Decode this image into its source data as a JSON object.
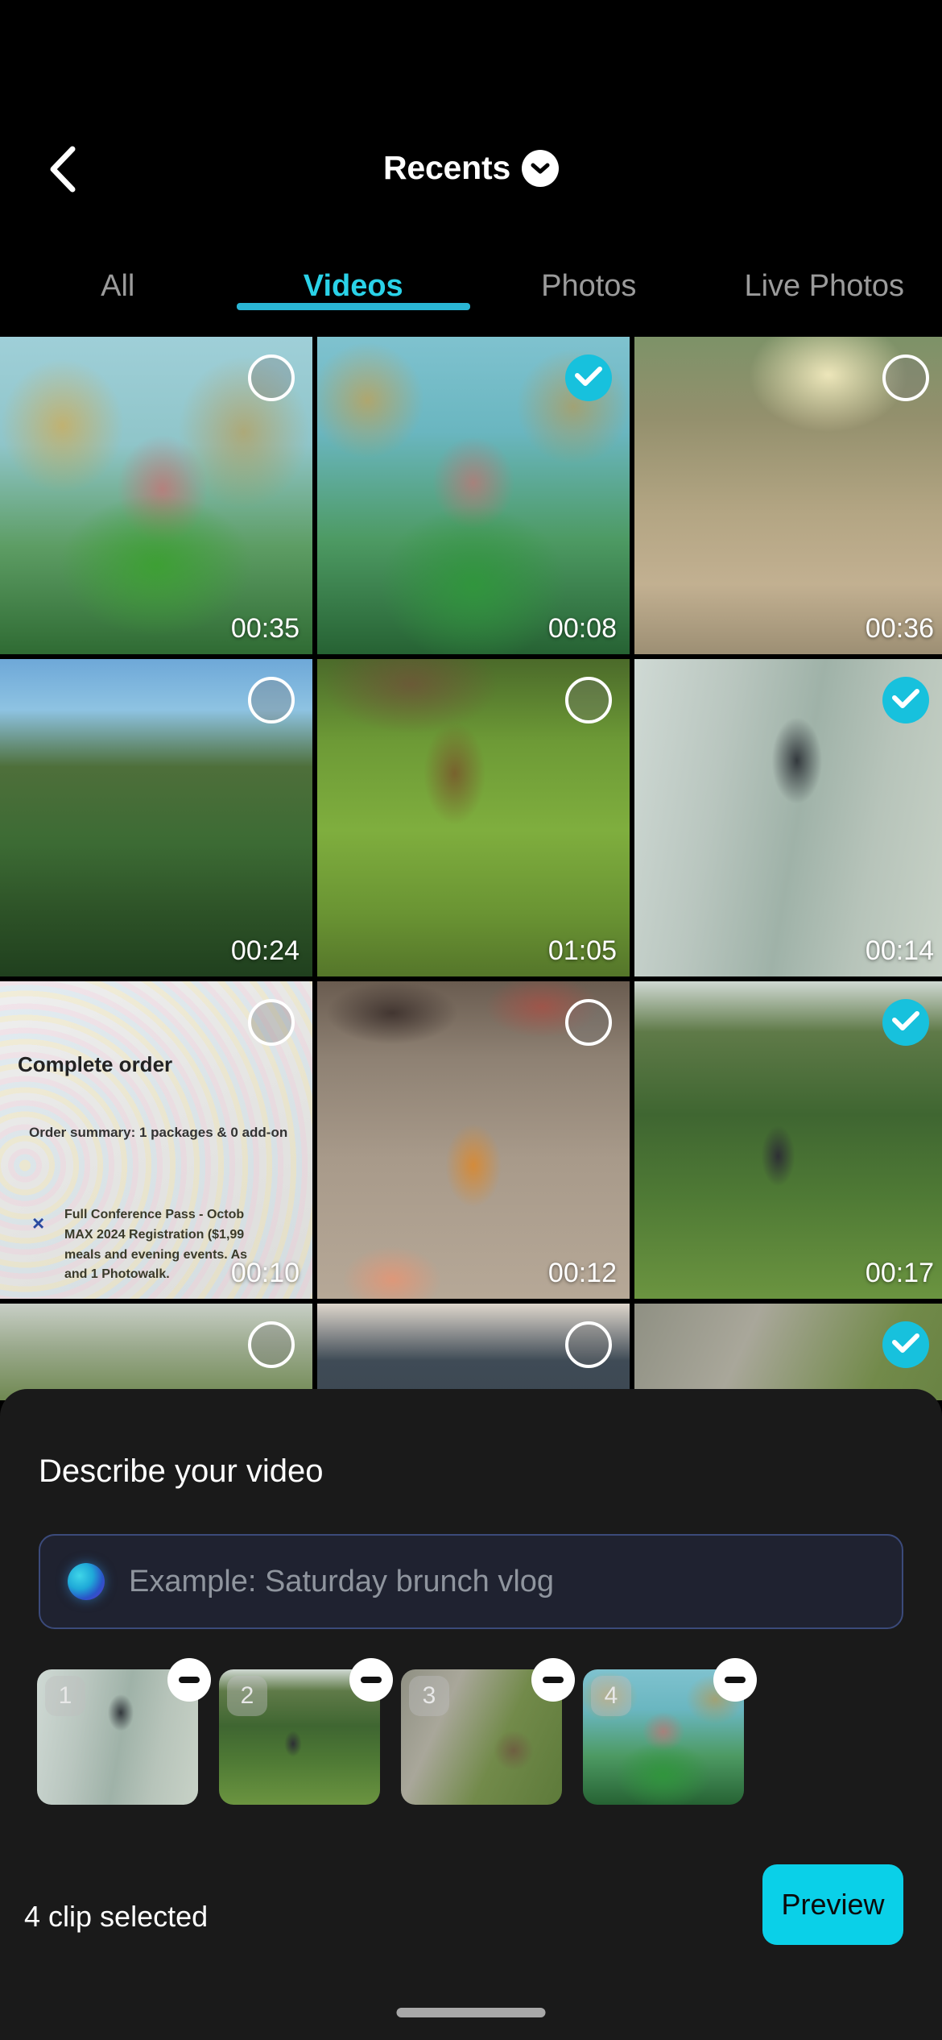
{
  "nav": {
    "back_icon": "chevron-left-icon",
    "title": "Recents",
    "chevron_icon": "chevron-down-icon"
  },
  "tabs": [
    {
      "label": "All",
      "active": false
    },
    {
      "label": "Videos",
      "active": true
    },
    {
      "label": "Photos",
      "active": false
    },
    {
      "label": "Live Photos",
      "active": false
    }
  ],
  "grid": {
    "items": [
      {
        "duration": "00:35",
        "selected": false,
        "art": "aquarium",
        "alt": "aquarium with fish and pagoda"
      },
      {
        "duration": "00:08",
        "selected": true,
        "art": "aquarium2",
        "alt": "aquarium with pagoda and plants"
      },
      {
        "duration": "00:36",
        "selected": false,
        "art": "lane",
        "alt": "sunlit country lane"
      },
      {
        "duration": "00:24",
        "selected": false,
        "art": "field",
        "alt": "green field with trees"
      },
      {
        "duration": "01:05",
        "selected": false,
        "art": "grassdog",
        "alt": "dog running in grass"
      },
      {
        "duration": "00:14",
        "selected": true,
        "art": "walkdog",
        "alt": "dog on a leash walking on path"
      },
      {
        "duration": "00:10",
        "selected": false,
        "art": "docorder",
        "alt": "screen showing complete order page"
      },
      {
        "duration": "00:12",
        "selected": false,
        "art": "carpetcat",
        "alt": "orange cat sitting on carpet"
      },
      {
        "duration": "00:17",
        "selected": true,
        "art": "gardendog",
        "alt": "dog standing in garden"
      },
      {
        "duration": "",
        "selected": false,
        "art": "hedge",
        "alt": "hedge and path"
      },
      {
        "duration": "",
        "selected": false,
        "art": "room",
        "alt": "dark interior room"
      },
      {
        "duration": "",
        "selected": true,
        "art": "stonepath",
        "alt": "dog on stone path"
      }
    ],
    "document_thumb": {
      "heading": "Complete order",
      "summary": "Order summary: 1 packages & 0 add-on",
      "x_mark": "×",
      "body_line1": "Full Conference Pass - Octob",
      "body_line2": "MAX 2024 Registration ($1,99",
      "body_line3": "meals and evening events. As",
      "body_line4": "and 1 Photowalk."
    }
  },
  "sheet": {
    "title": "Describe your video",
    "input": {
      "value": "",
      "placeholder": "Example: Saturday brunch vlog",
      "icon": "ai-sparkle-orb-icon"
    },
    "clips": [
      {
        "number": "1",
        "art": "walkdog",
        "remove_icon": "minus-circle-icon",
        "alt": "dog on a leash walking on path"
      },
      {
        "number": "2",
        "art": "gardendog",
        "remove_icon": "minus-circle-icon",
        "alt": "dog standing in garden"
      },
      {
        "number": "3",
        "art": "stonepath",
        "remove_icon": "minus-circle-icon",
        "alt": "dog on stone path"
      },
      {
        "number": "4",
        "art": "aquarium2",
        "remove_icon": "minus-circle-icon",
        "alt": "aquarium with pagoda"
      }
    ],
    "selection_count": "4 clip selected",
    "preview_label": "Preview"
  },
  "colors": {
    "accent_cyan": "#0ad0e8",
    "tab_active": "#2ad2e8",
    "tab_underline": "#2ab5d4",
    "check_badge": "#17c1dd",
    "sheet_bg": "#1a1a1a",
    "page_bg": "#000000",
    "input_border": "#3b4a7a",
    "input_bg": "#1f2230",
    "placeholder_text": "#8f959e",
    "inactive_tab_text": "#9b9b9b"
  }
}
